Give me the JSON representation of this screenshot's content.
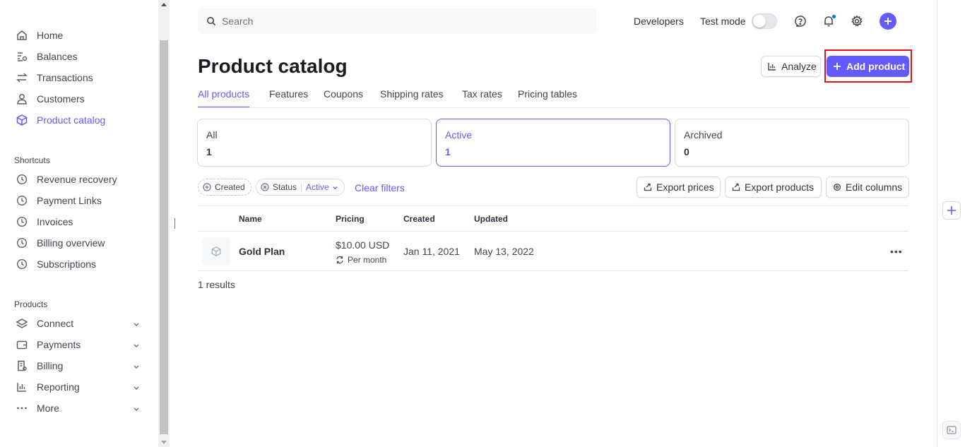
{
  "sidebar": {
    "main_items": [
      {
        "label": "Home",
        "icon": "home-icon"
      },
      {
        "label": "Balances",
        "icon": "balances-icon"
      },
      {
        "label": "Transactions",
        "icon": "transactions-icon"
      },
      {
        "label": "Customers",
        "icon": "person-icon"
      },
      {
        "label": "Product catalog",
        "icon": "box-icon",
        "active": true
      }
    ],
    "shortcuts_label": "Shortcuts",
    "shortcuts": [
      {
        "label": "Revenue recovery",
        "icon": "clock-icon"
      },
      {
        "label": "Payment Links",
        "icon": "clock-icon"
      },
      {
        "label": "Invoices",
        "icon": "clock-icon"
      },
      {
        "label": "Billing overview",
        "icon": "clock-icon"
      },
      {
        "label": "Subscriptions",
        "icon": "clock-icon"
      }
    ],
    "products_label": "Products",
    "products": [
      {
        "label": "Connect",
        "icon": "layers-icon"
      },
      {
        "label": "Payments",
        "icon": "wallet-icon"
      },
      {
        "label": "Billing",
        "icon": "invoice-icon"
      },
      {
        "label": "Reporting",
        "icon": "bar-chart-icon"
      },
      {
        "label": "More",
        "icon": "ellipsis-icon"
      }
    ]
  },
  "topbar": {
    "search_placeholder": "Search",
    "developers": "Developers",
    "test_mode": "Test mode",
    "test_mode_on": false
  },
  "header": {
    "title": "Product catalog",
    "analyze": "Analyze",
    "add_product": "Add product"
  },
  "tabs": [
    "All products",
    "Features",
    "Coupons",
    "Shipping rates",
    "Tax rates",
    "Pricing tables"
  ],
  "status_cards": [
    {
      "label": "All",
      "count": "1"
    },
    {
      "label": "Active",
      "count": "1"
    },
    {
      "label": "Archived",
      "count": "0"
    }
  ],
  "filters": {
    "created": "Created",
    "status": "Status",
    "status_value": "Active",
    "clear": "Clear filters",
    "export_prices": "Export prices",
    "export_products": "Export products",
    "edit_columns": "Edit columns"
  },
  "table": {
    "columns": [
      "Name",
      "Pricing",
      "Created",
      "Updated"
    ],
    "rows": [
      {
        "name": "Gold Plan",
        "price": "$10.00 USD",
        "interval": "Per month",
        "created": "Jan 11, 2021",
        "updated": "May 13, 2022"
      }
    ],
    "results": "1 results"
  },
  "colors": {
    "accent": "#635bff",
    "highlight": "#e0131b"
  }
}
